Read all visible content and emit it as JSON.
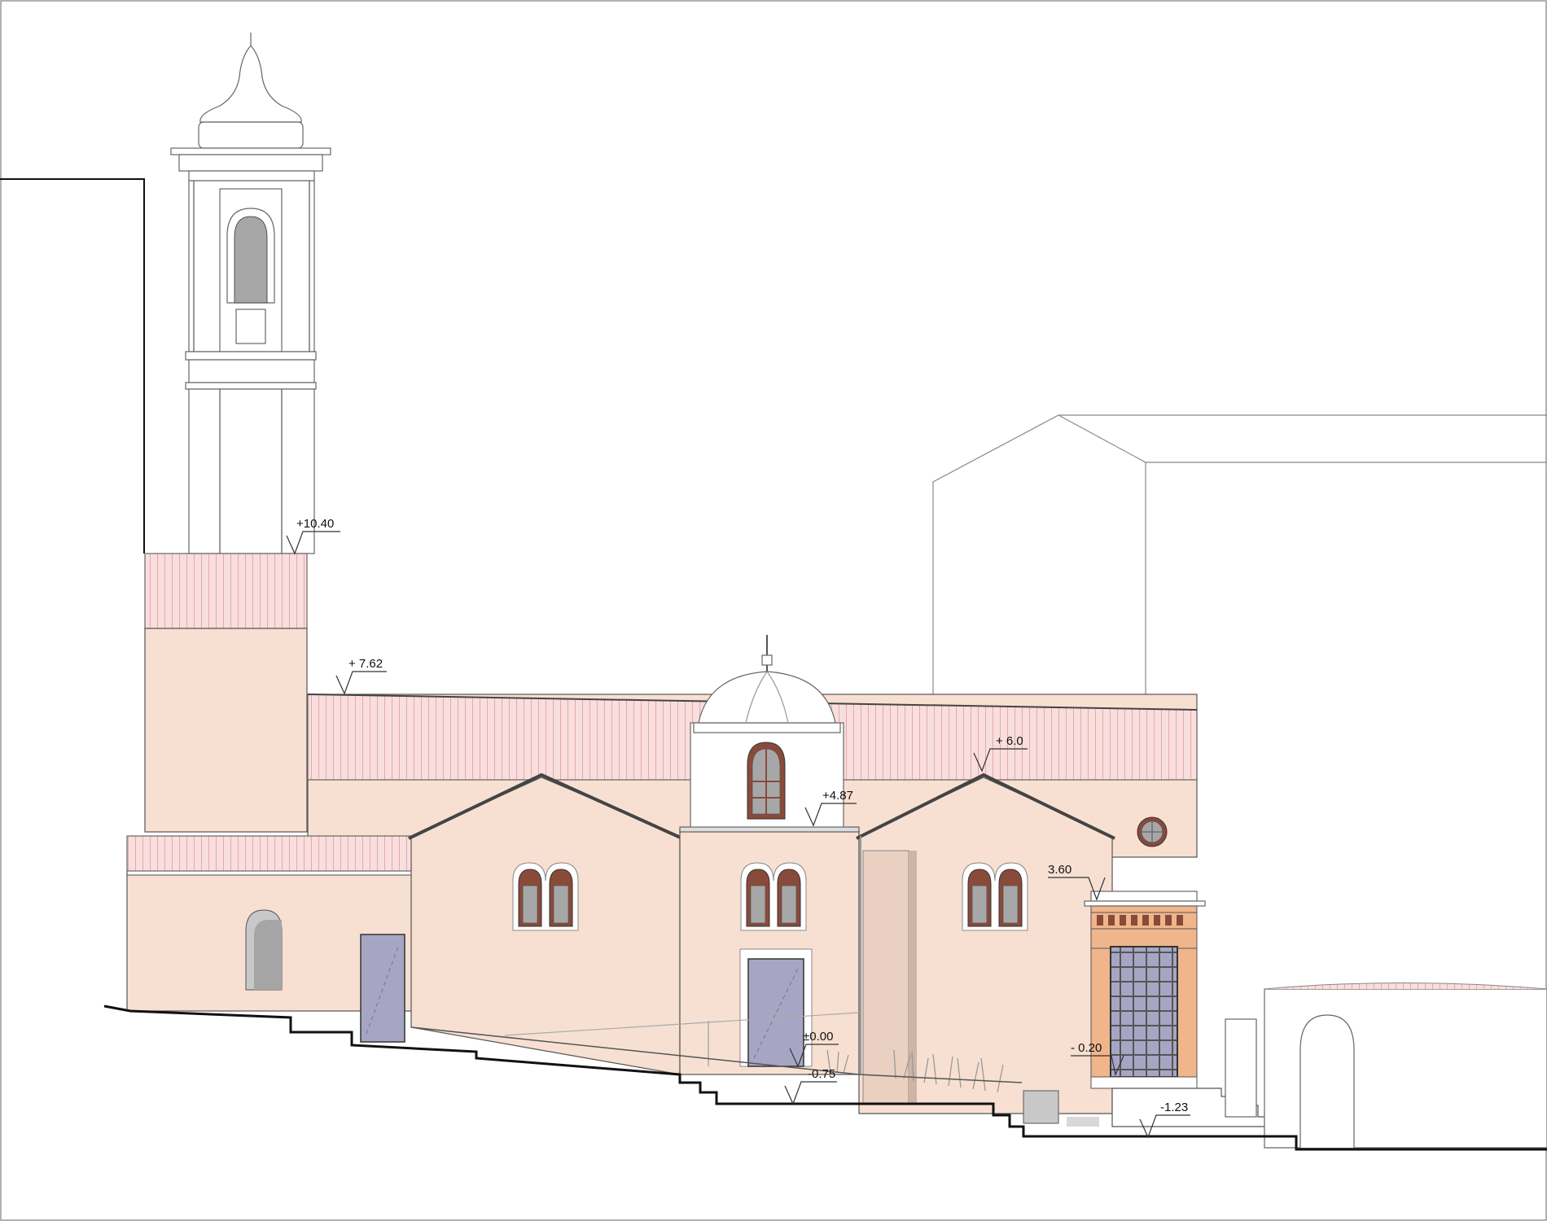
{
  "colors": {
    "wall": "#f7e0d2",
    "roof_tiles": "#f9dede",
    "door": "#a6a6c4",
    "window_frame": "#8a4a3a",
    "portal_frame": "#f0b58a",
    "outline": "#555555",
    "ground_line": "#111111"
  },
  "level_marks": [
    {
      "id": "level-bell-tower-base",
      "label": "+10.40"
    },
    {
      "id": "level-nave-roof",
      "label": "+ 7.62"
    },
    {
      "id": "level-right-gable",
      "label": "+ 6.0"
    },
    {
      "id": "level-dome-base",
      "label": "+4.87"
    },
    {
      "id": "level-portal-top",
      "label": "3.60"
    },
    {
      "id": "level-entrance",
      "label": "±0.00"
    },
    {
      "id": "level-forecourt",
      "label": "-0.75"
    },
    {
      "id": "level-portal-floor",
      "label": "- 0.20"
    },
    {
      "id": "level-stair-bottom",
      "label": "-1.23"
    }
  ]
}
